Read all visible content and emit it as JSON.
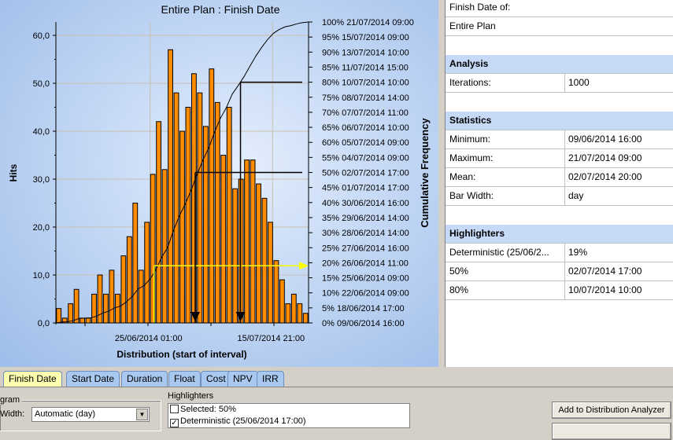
{
  "chart": {
    "title": "Entire Plan : Finish Date",
    "ylabel": "Hits",
    "xlabel": "Distribution (start of interval)",
    "y2label": "Cumulative Frequency",
    "yticks": [
      "0,0",
      "10,0",
      "20,0",
      "30,0",
      "40,0",
      "50,0",
      "60,0"
    ],
    "xticks": [
      "25/06/2014 01:00",
      "15/07/2014 21:00"
    ],
    "y2ticks": [
      "0%  09/06/2014 16:00",
      "5%  18/06/2014 17:00",
      "10%  22/06/2014 09:00",
      "15%  25/06/2014 09:00",
      "20%  26/06/2014 11:00",
      "25%  27/06/2014 16:00",
      "30%  28/06/2014 14:00",
      "35%  29/06/2014 14:00",
      "40%  30/06/2014 16:00",
      "45%  01/07/2014 17:00",
      "50%  02/07/2014 17:00",
      "55%  04/07/2014 09:00",
      "60%  05/07/2014 09:00",
      "65%  06/07/2014 10:00",
      "70%  07/07/2014 11:00",
      "75%  08/07/2014 14:00",
      "80%  10/07/2014 10:00",
      "85%  11/07/2014 15:00",
      "90%  13/07/2014 10:00",
      "95%  15/07/2014 09:00",
      "100%  21/07/2014 09:00"
    ],
    "colors": {
      "bar": "#ff8c00",
      "deterministic": "#ffff00",
      "percentile": "#000000"
    }
  },
  "chart_data": {
    "type": "bar",
    "title": "Entire Plan : Finish Date",
    "xlabel": "Distribution (start of interval)",
    "ylabel": "Hits",
    "y2label": "Cumulative Frequency",
    "x_start": "09/06/2014",
    "bin": "day",
    "values": [
      3,
      1,
      4,
      7,
      1,
      1,
      6,
      10,
      6,
      11,
      6,
      14,
      18,
      25,
      11,
      21,
      31,
      42,
      32,
      57,
      48,
      40,
      45,
      52,
      48,
      41,
      53,
      46,
      35,
      45,
      28,
      30,
      34,
      34,
      29,
      26,
      21,
      13,
      9,
      4,
      6,
      4,
      2
    ],
    "ylim": [
      0,
      60
    ],
    "y2lim": [
      0,
      100
    ],
    "grid": true,
    "cumulative_line": true,
    "highlighters": [
      {
        "name": "Deterministic",
        "date": "25/06/2014 17:00",
        "percent": 19,
        "color": "#ffff00"
      },
      {
        "name": "50%",
        "date": "02/07/2014 17:00",
        "percent": 50,
        "color": "#000000"
      },
      {
        "name": "80%",
        "date": "10/07/2014 10:00",
        "percent": 80,
        "color": "#000000"
      }
    ]
  },
  "panel": {
    "rows": [
      {
        "k": "Finish Date of:"
      },
      {
        "k": "Entire Plan"
      },
      {
        "k": ""
      },
      {
        "k": "Analysis",
        "hdr": true
      },
      {
        "k": "Iterations:",
        "v": "1000"
      },
      {
        "k": ""
      },
      {
        "k": "Statistics",
        "hdr": true
      },
      {
        "k": "Minimum:",
        "v": "09/06/2014 16:00"
      },
      {
        "k": "Maximum:",
        "v": "21/07/2014 09:00"
      },
      {
        "k": "Mean:",
        "v": "02/07/2014 20:00"
      },
      {
        "k": "Bar Width:",
        "v": "day"
      },
      {
        "k": ""
      },
      {
        "k": "Highlighters",
        "hdr": true
      },
      {
        "k": "Deterministic (25/06/2...",
        "v": "19%"
      },
      {
        "k": "50%",
        "v": "02/07/2014 17:00"
      },
      {
        "k": "80%",
        "v": "10/07/2014 10:00"
      }
    ]
  },
  "tabs": [
    "Finish Date",
    "Start Date",
    "Duration",
    "Float",
    "Cost",
    "NPV",
    "IRR"
  ],
  "bottom": {
    "group_label": "gram",
    "width_label": "Width:",
    "width_value": "Automatic (day)",
    "highlighters_label": "Highlighters",
    "highlighters": [
      {
        "label": "Selected: 50%",
        "checked": false
      },
      {
        "label": "Deterministic (25/06/2014 17:00)",
        "checked": true
      }
    ],
    "add_button": "Add to Distribution Analyzer"
  }
}
